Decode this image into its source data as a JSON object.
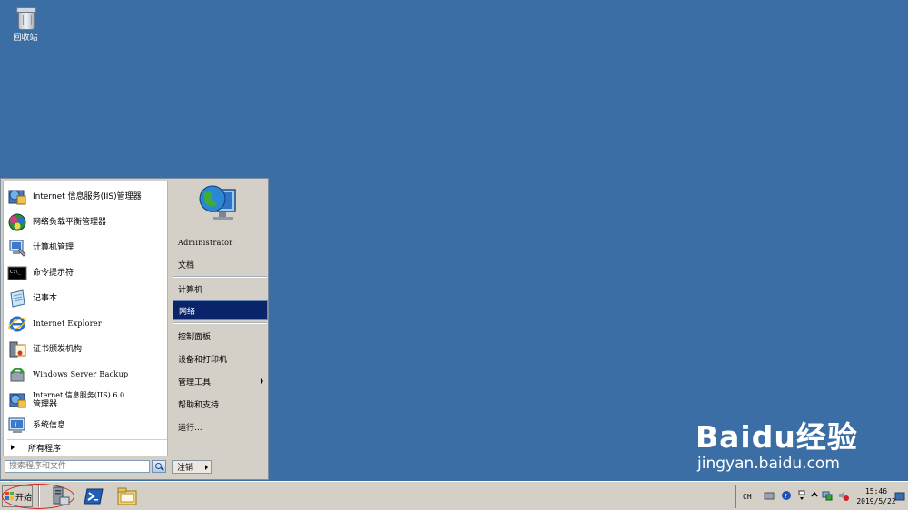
{
  "desktop": {
    "recycle_bin_label": "回收站"
  },
  "start_menu": {
    "programs": [
      {
        "label": "Internet 信息服务(IIS)管理器",
        "icon": "iis-manager-icon"
      },
      {
        "label": "网络负载平衡管理器",
        "icon": "network-load-balancing-icon"
      },
      {
        "label": "计算机管理",
        "icon": "computer-management-icon"
      },
      {
        "label": "命令提示符",
        "icon": "command-prompt-icon"
      },
      {
        "label": "记事本",
        "icon": "notepad-icon"
      },
      {
        "label": "Internet Explorer",
        "icon": "internet-explorer-icon"
      },
      {
        "label": "证书颁发机构",
        "icon": "certificate-authority-icon"
      },
      {
        "label": "Windows Server Backup",
        "icon": "server-backup-icon"
      },
      {
        "label_line1": "Internet 信息服务(IIS) 6.0",
        "label_line2": "管理器",
        "icon": "iis6-manager-icon"
      },
      {
        "label": "系统信息",
        "icon": "system-info-icon"
      }
    ],
    "all_programs": "所有程序",
    "search_placeholder": "搜索程序和文件",
    "right": {
      "user": "Administrator",
      "documents": "文档",
      "computer": "计算机",
      "network": "网络",
      "control_panel": "控制面板",
      "devices_printers": "设备和打印机",
      "admin_tools": "管理工具",
      "help_support": "帮助和支持",
      "run": "运行..."
    },
    "logoff": "注销"
  },
  "taskbar": {
    "start_label": "开始",
    "lang": "CH",
    "time": "15:46",
    "date": "2019/5/22"
  },
  "watermark": {
    "brand": "Baidu经验",
    "url": "jingyan.baidu.com"
  },
  "colors": {
    "desktop": "#3b6ea5",
    "selection": "#0a246a",
    "chrome": "#d4d0c8",
    "annotation": "#d21e1e"
  }
}
